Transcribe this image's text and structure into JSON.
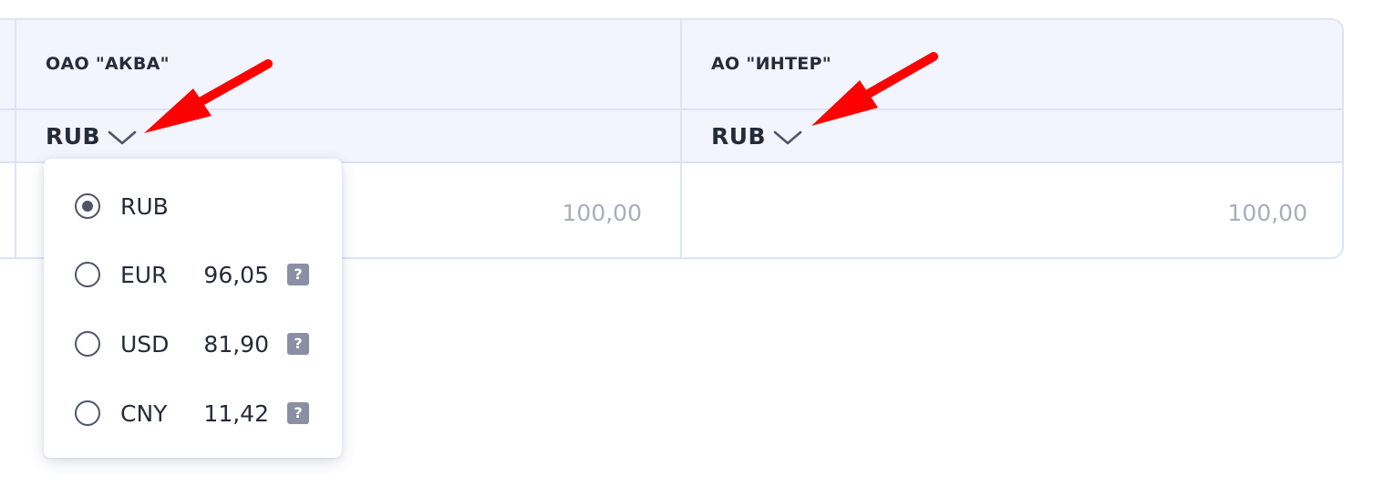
{
  "columns": [
    {
      "company": "ОАО \"АКВА\"",
      "currency": "RUB",
      "value": "100,00"
    },
    {
      "company": "АО \"ИНТЕР\"",
      "currency": "RUB",
      "value": "100,00"
    }
  ],
  "dropdown": {
    "selected": "RUB",
    "options": [
      {
        "code": "RUB",
        "rate": "",
        "help": ""
      },
      {
        "code": "EUR",
        "rate": "96,05",
        "help": "?"
      },
      {
        "code": "USD",
        "rate": "81,90",
        "help": "?"
      },
      {
        "code": "CNY",
        "rate": "11,42",
        "help": "?"
      }
    ]
  },
  "colors": {
    "header_bg": "#f2f4fe",
    "border": "#dfe3f3",
    "text": "#262b3a",
    "muted": "#a9adbb",
    "annotation_arrow": "#ff0000"
  },
  "icons": {
    "currency_toggle": "chevron-down-icon",
    "help": "question-mark-icon",
    "annotation": "red-arrow"
  }
}
